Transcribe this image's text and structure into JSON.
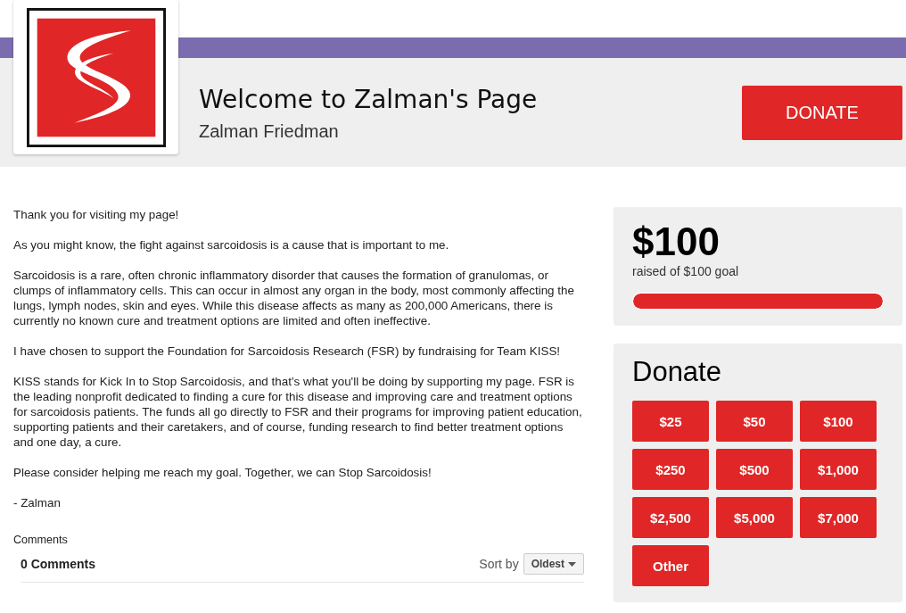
{
  "header": {
    "title": "Welcome to Zalman's Page",
    "name": "Zalman Friedman",
    "donate_button": "DONATE"
  },
  "story": [
    "Thank you for visiting my page!",
    "As you might know, the fight against sarcoidosis is a cause that is important to me.",
    "Sarcoidosis is a rare, often chronic inflammatory disorder that causes the formation of granulomas, or clumps of inflammatory cells. This can occur in almost any organ in the body, most commonly affecting the lungs, lymph nodes, skin and eyes. While this disease affects as many as 200,000 Americans, there is currently no known cure and treatment options are limited and often ineffective.",
    "I have chosen to support the Foundation for Sarcoidosis Research (FSR) by fundraising for Team KISS!",
    "KISS stands for Kick In to Stop Sarcoidosis, and that’s what you'll be doing by supporting my page. FSR is the leading nonprofit dedicated to finding a cure for this disease and improving care and treatment options for sarcoidosis patients. The funds all go directly to FSR and their programs for improving patient education, supporting patients and their caretakers, and of course, funding research to find better treatment options and one day, a cure.",
    "Please consider helping me reach my goal. Together, we can Stop Sarcoidosis!",
    "- Zalman"
  ],
  "comments": {
    "label": "Comments",
    "count": "0 Comments",
    "sort_label": "Sort by",
    "sort_value": "Oldest"
  },
  "progress": {
    "raised": "$100",
    "caption": "raised of $100 goal",
    "level": 1.0
  },
  "donate": {
    "title": "Donate",
    "amounts": [
      "$25",
      "$50",
      "$100",
      "$250",
      "$500",
      "$1,000",
      "$2,500",
      "$5,000",
      "$7,000",
      "Other"
    ]
  }
}
